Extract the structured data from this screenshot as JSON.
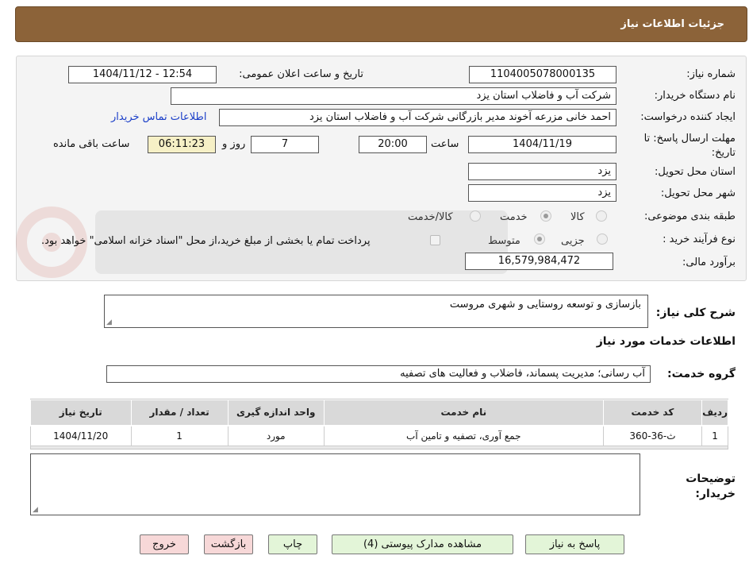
{
  "header": {
    "title": "جزئیات اطلاعات نیاز"
  },
  "form": {
    "need_number_label": "شماره نیاز:",
    "need_number_value": "1104005078000135",
    "announce_label": "تاریخ و ساعت اعلان عمومی:",
    "announce_value": "1404/11/12 - 12:54",
    "buyer_org_label": "نام دستگاه خریدار:",
    "buyer_org_value": "شرکت آب و فاضلاب استان یزد",
    "creator_label": "ایجاد کننده درخواست:",
    "creator_value": "احمد خانی مزرعه آخوند مدیر بازرگانی شرکت آب و فاضلاب استان یزد",
    "contact_link": "اطلاعات تماس خریدار",
    "deadline_label": "مهلت ارسال پاسخ: تا تاریخ:",
    "deadline_date": "1404/11/19",
    "time_label": "ساعت",
    "deadline_time": "20:00",
    "days_value": "7",
    "days_label": "روز و",
    "remaining_time": "06:11:23",
    "remaining_label": "ساعت باقی مانده",
    "province_label": "استان محل تحویل:",
    "province_value": "یزد",
    "city_label": "شهر محل تحویل:",
    "city_value": "یزد",
    "category_label": "طبقه بندی موضوعی:",
    "category_options": [
      "کالا",
      "خدمت",
      "کالا/خدمت"
    ],
    "category_selected": "خدمت",
    "process_label": "نوع فرآیند خرید :",
    "process_options": [
      "جزیی",
      "متوسط"
    ],
    "process_selected": "متوسط",
    "payment_note": "پرداخت تمام یا بخشی از مبلغ خرید،از محل \"اسناد خزانه اسلامی\" خواهد بود.",
    "estimate_label": "برآورد مالی:",
    "estimate_value": "16,579,984,472"
  },
  "description": {
    "label": "شرح کلی نیاز:",
    "value": "بازسازی و توسعه روستایی و شهری مروست"
  },
  "services": {
    "section_title": "اطلاعات خدمات مورد نیاز",
    "group_label": "گروه خدمت:",
    "group_value": "آب رسانی؛ مدیریت پسماند، فاضلاب و فعالیت های تصفیه",
    "table": {
      "headers": [
        "ردیف",
        "کد خدمت",
        "نام خدمت",
        "واحد اندازه گیری",
        "تعداد / مقدار",
        "تاریخ نیاز"
      ],
      "rows": [
        [
          "1",
          "ث-36-360",
          "جمع آوری، تصفیه و تامین آب",
          "مورد",
          "1",
          "1404/11/20"
        ]
      ]
    }
  },
  "buyer_notes": {
    "label": "توضیحات خریدار:",
    "value": ""
  },
  "buttons": {
    "reply": "پاسخ به نیاز",
    "attachments": "مشاهده مدارک پیوستی (4)",
    "print": "چاپ",
    "back": "بازگشت",
    "exit": "خروج"
  },
  "colors": {
    "header_bg": "#8c6339",
    "panel_bg": "#f4f4f4",
    "link": "#1a3ec8",
    "btn_green": "#e3f5d8",
    "btn_pink": "#f7d8d8"
  },
  "icons": {
    "watermark": "ariatender-logo",
    "resize": "resize-grip-icon"
  }
}
